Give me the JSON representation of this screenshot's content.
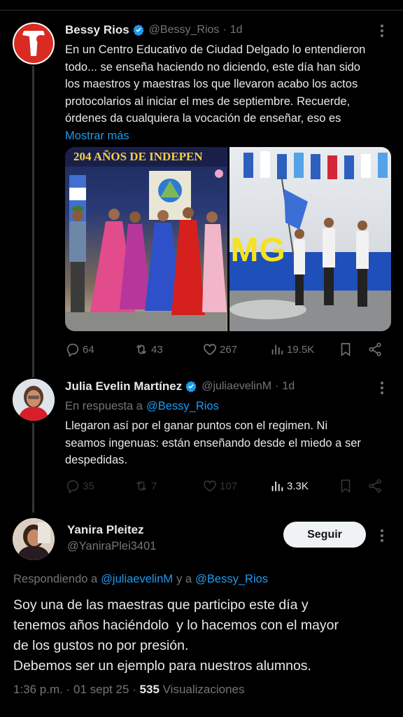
{
  "tweet1": {
    "name": "Bessy Rios",
    "handle": "@Bessy_Rios",
    "time": "1d",
    "lines": [
      "En un Centro Educativo de Ciudad Delgado lo entendieron",
      "todo... se enseña haciendo no diciendo, este día han sido",
      "los maestros y maestras los que llevaron acabo los actos",
      "protocolarios al iniciar el mes de septiembre. Recuerde,",
      "órdenes da cualquiera la vocación de enseñar, eso es"
    ],
    "show_more": "Mostrar más",
    "banner_text": "204 AÑOS DE INDEPEN",
    "mg_text": "MG",
    "stats": {
      "replies": "64",
      "reposts": "43",
      "likes": "267",
      "views": "19.5K"
    }
  },
  "tweet2": {
    "name": "Julia Evelin Martínez",
    "handle": "@juliaevelinM",
    "time": "1d",
    "reply_prefix": "En respuesta a",
    "reply_to": "@Bessy_Rios",
    "lines": [
      "Llegaron así por el ganar puntos con el regimen. Ni",
      "seamos ingenuas: están enseñando desde el miedo a ser",
      "despedidas."
    ],
    "stats": {
      "replies": "35",
      "reposts": "7",
      "likes": "107",
      "views": "3.3K"
    }
  },
  "tweet3": {
    "name": "Yanira Pleitez",
    "handle": "@YaniraPlei3401",
    "follow_label": "Seguir",
    "replying_prefix": "Respondiendo a",
    "replying_to_1": "@juliaevelinM",
    "replying_and": "y a",
    "replying_to_2": "@Bessy_Rios",
    "lines": [
      "Soy una de las maestras que participo este día y",
      "tenemos años haciéndolo  y lo hacemos con el mayor",
      "de los gustos no por presión.",
      "Debemos ser un ejemplo para nuestros alumnos."
    ],
    "time": "1:36 p.m.",
    "date": "01 sept 25",
    "views_count": "535",
    "views_label": "Visualizaciones"
  },
  "colors": {
    "accent": "#1d9bf0",
    "muted": "#71767b",
    "background": "#000000"
  }
}
